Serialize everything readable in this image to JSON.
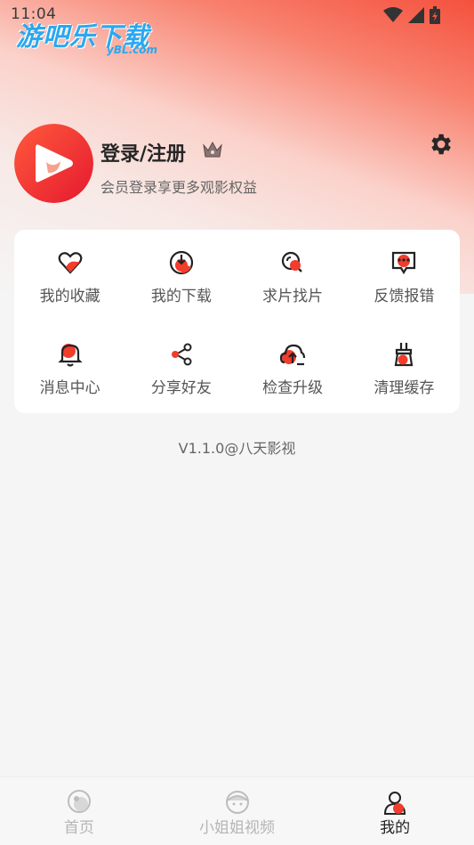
{
  "status_bar": {
    "time": "11:04"
  },
  "watermark": {
    "main": "游吧乐下载",
    "sub": "yBL.com"
  },
  "profile": {
    "login_title": "登录/注册",
    "subtitle": "会员登录享更多观影权益"
  },
  "menu": {
    "items": [
      {
        "label": "我的收藏",
        "icon": "heart-icon"
      },
      {
        "label": "我的下载",
        "icon": "download-icon"
      },
      {
        "label": "求片找片",
        "icon": "search-film-icon"
      },
      {
        "label": "反馈报错",
        "icon": "feedback-icon"
      },
      {
        "label": "消息中心",
        "icon": "bell-icon"
      },
      {
        "label": "分享好友",
        "icon": "share-icon"
      },
      {
        "label": "检查升级",
        "icon": "cloud-upgrade-icon"
      },
      {
        "label": "清理缓存",
        "icon": "broom-icon"
      }
    ]
  },
  "version": "V1.1.0@八天影视",
  "tabbar": {
    "tabs": [
      {
        "label": "首页",
        "icon": "home-icon",
        "active": false
      },
      {
        "label": "小姐姐视频",
        "icon": "girl-video-icon",
        "active": false
      },
      {
        "label": "我的",
        "icon": "profile-icon",
        "active": true
      }
    ]
  },
  "colors": {
    "accent": "#f23c2c",
    "brand_gradient_start": "#f4513d",
    "watermark": "#2aa8f0"
  }
}
